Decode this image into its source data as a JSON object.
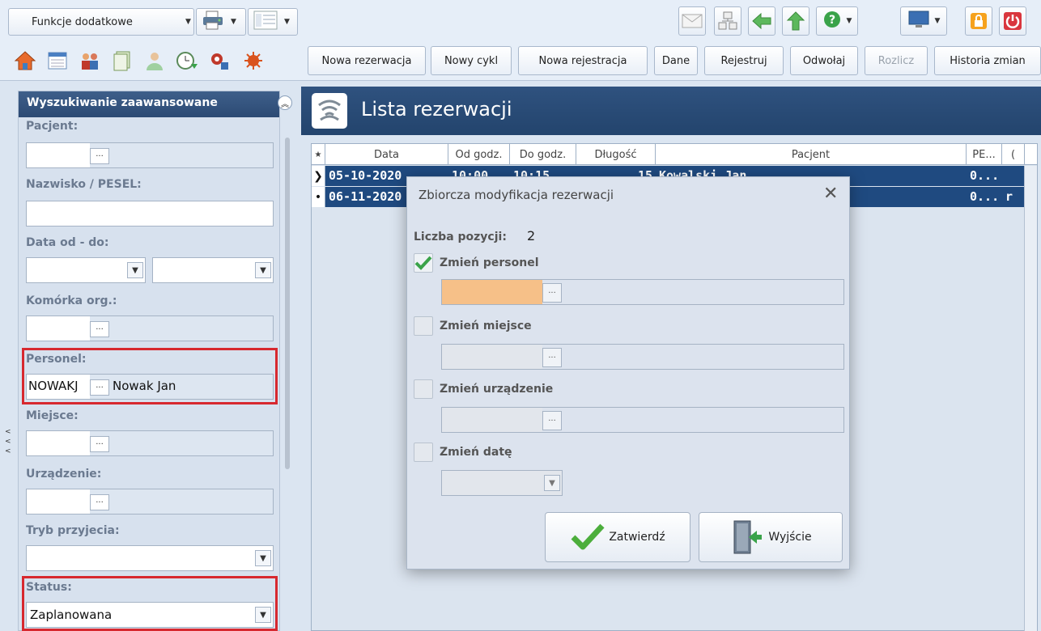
{
  "toolbar1": {
    "functions_label": "Funkcje dodatkowe"
  },
  "toolbar2": {
    "buttons": [
      "Nowa rezerwacja",
      "Nowy cykl",
      "Nowa rejestracja",
      "Dane",
      "Rejestruj",
      "Odwołaj",
      "Rozlicz",
      "Historia zmian"
    ]
  },
  "icons": {
    "toolbar1_left": [
      "printer-icon",
      "layout-icon"
    ],
    "toolbar1_right": [
      "mail-icon",
      "network-icon",
      "back-arrow-icon",
      "up-arrow-icon",
      "help-icon",
      "monitor-icon",
      "lock-icon",
      "power-icon"
    ],
    "toolbar2_modules": [
      "home-icon",
      "calendar-icon",
      "people-icon",
      "documents-icon",
      "staff-icon",
      "clock-arrow-icon",
      "tools-icon",
      "virus-icon"
    ]
  },
  "search_panel": {
    "title": "Wyszukiwanie zaawansowane",
    "patient_label": "Pacjent:",
    "surname_label": "Nazwisko / PESEL:",
    "date_label": "Data od - do:",
    "org_unit_label": "Komórka org.:",
    "staff_label": "Personel:",
    "staff_code": "NOWAKJ",
    "staff_name": "Nowak Jan",
    "place_label": "Miejsce:",
    "device_label": "Urządzenie:",
    "admission_label": "Tryb przyjecia:",
    "status_label": "Status:",
    "status_value": "Zaplanowana"
  },
  "list": {
    "title": "Lista rezerwacji",
    "columns": [
      "Data",
      "Od godz.",
      "Do godz.",
      "Długość",
      "Pacjent",
      "PE...",
      "("
    ],
    "rows": [
      {
        "marker": "❯",
        "date": "05-10-2020",
        "from": "10:00",
        "to": "10:15",
        "length": "15",
        "patient": "Kowalski Jan",
        "pesel": "0...",
        "extra": ""
      },
      {
        "marker": "•",
        "date": "06-11-2020",
        "from": "",
        "to": "",
        "length": "",
        "patient": "",
        "pesel": "0...",
        "extra": "r"
      }
    ]
  },
  "dialog": {
    "title": "Zbiorcza modyfikacja rezerwacji",
    "count_label": "Liczba pozycji:",
    "count_value": "2",
    "change_staff": "Zmień personel",
    "change_place": "Zmień miejsce",
    "change_device": "Zmień urządzenie",
    "change_date": "Zmień datę",
    "confirm": "Zatwierdź",
    "exit": "Wyjście",
    "staff_checked": true
  },
  "colors": {
    "highlight": "#d7282f",
    "header_blue": "#2c4a74",
    "selected_row": "#1f4a80",
    "active_field": "#f6c088"
  }
}
